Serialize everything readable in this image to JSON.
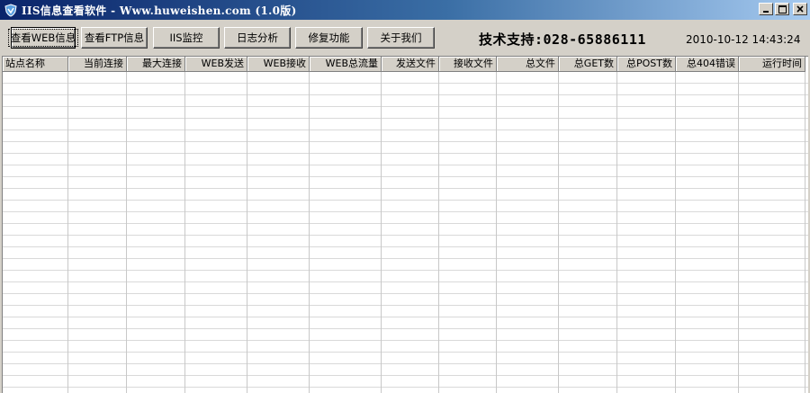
{
  "window": {
    "title": "IIS信息查看软件 - Www.huweishen.com (1.0版)",
    "icon": "shield-icon",
    "controls": [
      "minimize-icon",
      "maximize-icon",
      "close-icon"
    ]
  },
  "toolbar": {
    "buttons": [
      {
        "label": "查看WEB信息",
        "active": true
      },
      {
        "label": "查看FTP信息"
      },
      {
        "label": "IIS监控"
      },
      {
        "label": "日志分析"
      },
      {
        "label": "修复功能"
      },
      {
        "label": "关于我们"
      }
    ],
    "support": "技术支持:028-65886111",
    "datetime": "2010-10-12 14:43:24"
  },
  "table": {
    "columns": [
      "站点名称",
      "当前连接",
      "最大连接",
      "WEB发送",
      "WEB接收",
      "WEB总流量",
      "发送文件",
      "接收文件",
      "总文件",
      "总GET数",
      "总POST数",
      "总404错误",
      "运行时间"
    ],
    "rows": []
  }
}
